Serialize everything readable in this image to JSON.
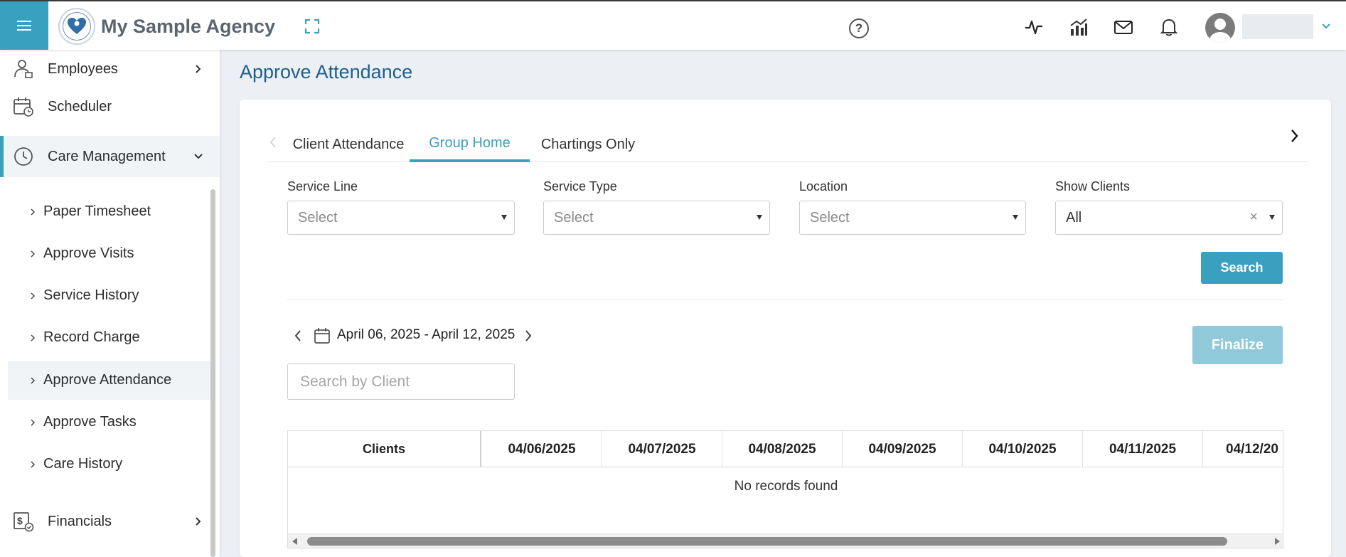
{
  "header": {
    "agency_name": "My Sample Agency",
    "icons": [
      "menu-icon",
      "expand-icon",
      "help-icon",
      "activity-icon",
      "analytics-icon",
      "mail-icon",
      "bell-icon",
      "avatar",
      "chevron-down-icon"
    ],
    "help_glyph": "?"
  },
  "sidebar": {
    "employees": "Employees",
    "scheduler": "Scheduler",
    "care_management": "Care Management",
    "financials": "Financials",
    "sub_items": [
      "Paper Timesheet",
      "Approve Visits",
      "Service History",
      "Record Charge",
      "Approve Attendance",
      "Approve Tasks",
      "Care History"
    ],
    "selected": "Approve Attendance"
  },
  "page": {
    "title": "Approve Attendance"
  },
  "tabs": {
    "items": [
      "Client Attendance",
      "Group Home",
      "Chartings Only"
    ],
    "active": "Group Home"
  },
  "filters": {
    "service_line": {
      "label": "Service Line",
      "value": "Select"
    },
    "service_type": {
      "label": "Service Type",
      "value": "Select"
    },
    "location": {
      "label": "Location",
      "value": "Select"
    },
    "show_clients": {
      "label": "Show Clients",
      "value": "All",
      "clear_glyph": "×"
    }
  },
  "actions": {
    "search": "Search",
    "finalize": "Finalize"
  },
  "week": {
    "range": "April 06, 2025 - April 12, 2025"
  },
  "client_search": {
    "placeholder": "Search by Client"
  },
  "grid": {
    "clients_header": "Clients",
    "dates": [
      "04/06/2025",
      "04/07/2025",
      "04/08/2025",
      "04/09/2025",
      "04/10/2025",
      "04/11/2025",
      "04/12/20"
    ],
    "empty_message": "No records found"
  },
  "colors": {
    "accent": "#3aa0c0",
    "title": "#1f5f8b",
    "finalize_disabled": "#8fc9da",
    "background": "#eceff3"
  }
}
